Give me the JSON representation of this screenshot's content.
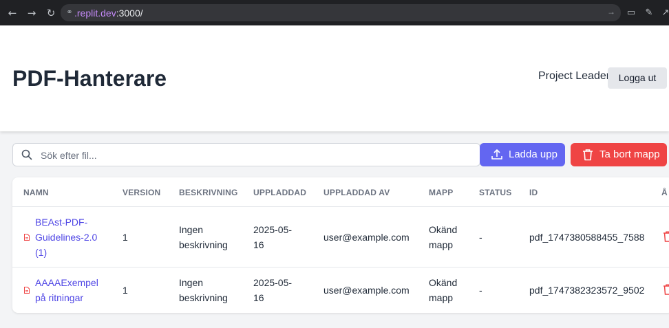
{
  "browser": {
    "url_host": ".replit.dev",
    "url_rest": ":3000/"
  },
  "header": {
    "title": "PDF-Hanterare",
    "user": "Project Leader",
    "logout_label": "Logga ut"
  },
  "toolbar": {
    "search_placeholder": "Sök efter fil...",
    "upload_label": "Ladda upp",
    "delete_folder_label": "Ta bort mapp"
  },
  "colors": {
    "accent": "#6366f1",
    "danger": "#ef4444",
    "link": "#4f46e5"
  },
  "table": {
    "columns": [
      "NAMN",
      "VERSION",
      "BESKRIVNING",
      "UPPLADDAD",
      "UPPLADDAD AV",
      "MAPP",
      "STATUS",
      "ID",
      "Å"
    ],
    "rows": [
      {
        "name_lines": [
          "BEAst-PDF-",
          "Guidelines-2.0",
          "(1)"
        ],
        "version": "1",
        "description_lines": [
          "Ingen",
          "beskrivning"
        ],
        "uploaded_lines": [
          "2025-05-",
          "16"
        ],
        "uploaded_by": "user@example.com",
        "folder_lines": [
          "Okänd",
          "mapp"
        ],
        "status": "-",
        "id": "pdf_1747380588455_7588"
      },
      {
        "name_lines": [
          "AAAAExempel",
          "på ritningar"
        ],
        "version": "1",
        "description_lines": [
          "Ingen",
          "beskrivning"
        ],
        "uploaded_lines": [
          "2025-05-",
          "16"
        ],
        "uploaded_by": "user@example.com",
        "folder_lines": [
          "Okänd",
          "mapp"
        ],
        "status": "-",
        "id": "pdf_1747382323572_9502"
      }
    ]
  }
}
